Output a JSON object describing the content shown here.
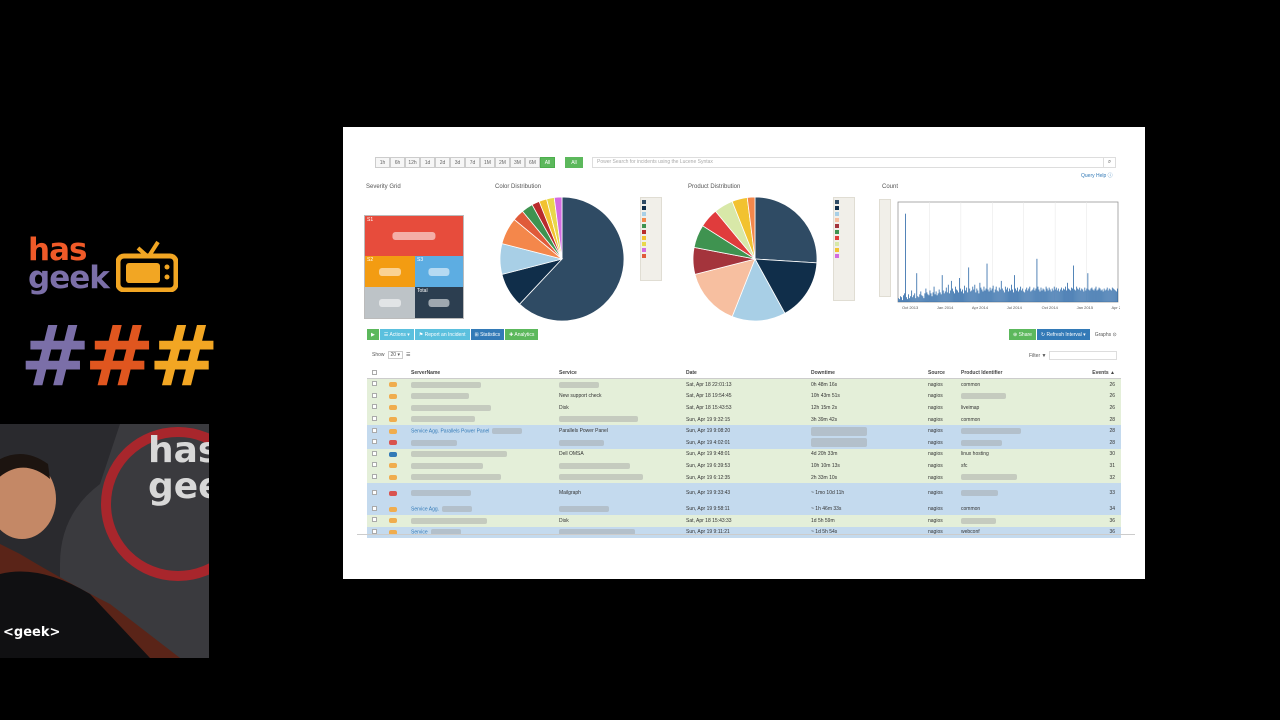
{
  "branding": {
    "line1": "has",
    "line2": "geek",
    "hashes": "###"
  },
  "colors": {
    "green": "#5cb85c",
    "blue": "#337ab7",
    "row_green": "#e4efd9",
    "row_blue": "#c4daee",
    "critical": "#e74c3c",
    "warning": "#f39c12",
    "unknown": "#5dade2",
    "total": "#2c3e50"
  },
  "toolbar": {
    "ranges": [
      "1h",
      "6h",
      "12h",
      "1d",
      "2d",
      "3d",
      "7d",
      "1M",
      "2M",
      "3M",
      "6M",
      "All"
    ],
    "active": "All",
    "all_button": "All",
    "search_placeholder": "Power Search for incidents using the Lucene Syntax",
    "query_help": "Query Help ⓘ"
  },
  "panels": {
    "severity_title": "Severity Grid",
    "color_title": "Color Distribution",
    "product_title": "Product Distribution",
    "count_title": "Count"
  },
  "severity_grid": {
    "cells": [
      {
        "key": "S1",
        "color": "#e74c3c"
      },
      {
        "key": "S2",
        "color": "#f39c12"
      },
      {
        "key": "S3",
        "color": "#5dade2"
      },
      {
        "key": "",
        "color": "#bdc3c7"
      },
      {
        "key": "Total",
        "color": "#2c3e50"
      }
    ]
  },
  "color_pie": {
    "slices": [
      {
        "value": 62,
        "color": "#2f4b64"
      },
      {
        "value": 9,
        "color": "#102e4a"
      },
      {
        "value": 8,
        "color": "#a8cfe6"
      },
      {
        "value": 7,
        "color": "#f4874b"
      },
      {
        "value": 3,
        "color": "#e05b3a"
      },
      {
        "value": 3,
        "color": "#3f9350"
      },
      {
        "value": 2,
        "color": "#b92c2c"
      },
      {
        "value": 2,
        "color": "#f2c230"
      },
      {
        "value": 2,
        "color": "#e8d84a"
      },
      {
        "value": 2,
        "color": "#d36be0"
      }
    ],
    "legend_colors": [
      "#2f4b64",
      "#102e4a",
      "#a8cfe6",
      "#f4874b",
      "#3f9350",
      "#b92c2c",
      "#f2c230",
      "#e8d84a",
      "#d36be0",
      "#e05b3a"
    ]
  },
  "product_pie": {
    "slices": [
      {
        "value": 26,
        "color": "#2f4b64"
      },
      {
        "value": 16,
        "color": "#102e4a"
      },
      {
        "value": 14,
        "color": "#a8cfe6"
      },
      {
        "value": 15,
        "color": "#f7bfa0"
      },
      {
        "value": 7,
        "color": "#a4343c"
      },
      {
        "value": 6,
        "color": "#3f9350"
      },
      {
        "value": 5,
        "color": "#e03c3c"
      },
      {
        "value": 5,
        "color": "#d8e8a8"
      },
      {
        "value": 4,
        "color": "#f2c230"
      },
      {
        "value": 2,
        "color": "#f4874b"
      }
    ],
    "legend_colors": [
      "#2f4b64",
      "#102e4a",
      "#a8cfe6",
      "#f7bfa0",
      "#a4343c",
      "#3f9350",
      "#e03c3c",
      "#d8e8a8",
      "#f2c230",
      "#d36be0"
    ]
  },
  "chart_data": {
    "type": "bar",
    "title": "Count",
    "x_ticks": [
      "Oct 2013",
      "Jan 2014",
      "Apr 2014",
      "Jul 2014",
      "Oct 2014",
      "Jan 2015",
      "Apr 2015"
    ],
    "ylim": [
      0,
      100
    ],
    "values": [
      4,
      3,
      6,
      5,
      2,
      7,
      9,
      92,
      5,
      3,
      8,
      4,
      6,
      12,
      5,
      7,
      9,
      4,
      30,
      6,
      5,
      8,
      11,
      7,
      6,
      4,
      9,
      14,
      10,
      8,
      7,
      12,
      9,
      6,
      10,
      16,
      8,
      11,
      7,
      9,
      13,
      10,
      8,
      28,
      12,
      9,
      11,
      15,
      10,
      18,
      9,
      12,
      22,
      14,
      11,
      9,
      16,
      13,
      12,
      10,
      25,
      14,
      11,
      13,
      9,
      17,
      12,
      15,
      10,
      36,
      14,
      11,
      12,
      16,
      13,
      18,
      10,
      14,
      12,
      9,
      20,
      15,
      13,
      11,
      16,
      12,
      14,
      40,
      13,
      11,
      15,
      12,
      14,
      17,
      10,
      13,
      16,
      12,
      11,
      15,
      13,
      22,
      14,
      12,
      10,
      16,
      13,
      15,
      11,
      14,
      12,
      18,
      13,
      10,
      28,
      14,
      12,
      15,
      11,
      13,
      16,
      12,
      14,
      11,
      10,
      13,
      15,
      12,
      14,
      16,
      11,
      12,
      13,
      15,
      12,
      14,
      45,
      16,
      13,
      11,
      15,
      12,
      14,
      13,
      11,
      16,
      14,
      12,
      15,
      13,
      11,
      14,
      12,
      16,
      13,
      15,
      12,
      14,
      11,
      13,
      15,
      12,
      14,
      13,
      16,
      12,
      20,
      14,
      13,
      12,
      15,
      14,
      38,
      13,
      12,
      16,
      14,
      13,
      15,
      12,
      14,
      13,
      11,
      15,
      12,
      14,
      30,
      13,
      12,
      14,
      15,
      13,
      12,
      14,
      16,
      12,
      13,
      15,
      14,
      12,
      13,
      11,
      14,
      12,
      13,
      15,
      12,
      14,
      13,
      12,
      15,
      14,
      13,
      12,
      11,
      14
    ]
  },
  "actions": {
    "buttons": [
      {
        "label": "▶",
        "color": "#5cb85c"
      },
      {
        "label": "☰ Actions ▾",
        "color": "#5bc0de"
      },
      {
        "label": "⚑ Report an Incident",
        "color": "#5bc0de"
      },
      {
        "label": "⊞ Statistics",
        "color": "#337ab7"
      },
      {
        "label": "✚ Analytics",
        "color": "#5cb85c"
      }
    ],
    "share": "⊕ Share",
    "refresh": "↻ Refresh Interval ▾",
    "graphs": "Graphs ⊙"
  },
  "table_controls": {
    "show_label": "Show",
    "show_value": "20 ▾",
    "filter_label": "Filter ▼"
  },
  "table": {
    "columns": [
      "",
      "",
      "ServerName",
      "Service",
      "Date",
      "Downtime",
      "Source",
      "Product Identifier",
      "Events ▲"
    ],
    "rows": [
      {
        "tone": "green",
        "badge": "#f0ad4e",
        "server": "",
        "service": "",
        "date": "Sat, Apr 18 22:01:13",
        "downtime": "0h 48m 16s",
        "source": "nagios",
        "product": "common",
        "events": "26"
      },
      {
        "tone": "green",
        "badge": "#f0ad4e",
        "server": "",
        "service": "New support check",
        "date": "Sat, Apr 18 19:54:45",
        "downtime": "10h 43m 51s",
        "source": "nagios",
        "product": "",
        "events": "26"
      },
      {
        "tone": "green",
        "badge": "#f0ad4e",
        "server": "",
        "service": "Disk",
        "date": "Sat, Apr 18 15:43:53",
        "downtime": "12h 15m 2s",
        "source": "nagios",
        "product": "liveimap",
        "events": "26"
      },
      {
        "tone": "green",
        "badge": "#f0ad4e",
        "server": "",
        "service": "",
        "date": "Sun, Apr 19 9:32:15",
        "downtime": "3h 39m 42s",
        "source": "nagios",
        "product": "common",
        "events": "28"
      },
      {
        "tone": "blue",
        "badge": "#f0ad4e",
        "server": "Service Agg. Parallels Power Panel",
        "service": "Parallels Power Panel",
        "date": "Sun, Apr 19 9:08:20",
        "downtime": "",
        "source": "nagios",
        "product": "",
        "events": "28"
      },
      {
        "tone": "blue",
        "badge": "#d9534f",
        "server": "",
        "service": "",
        "date": "Sun, Apr 19 4:02:01",
        "downtime": "",
        "source": "nagios",
        "product": "",
        "events": "28"
      },
      {
        "tone": "green",
        "badge": "#337ab7",
        "server": "",
        "service": "Dell OMSA",
        "date": "Sun, Apr 19 9:48:01",
        "downtime": "4d 20h 33m",
        "source": "nagios",
        "product": "linux hosting",
        "events": "30"
      },
      {
        "tone": "green",
        "badge": "#f0ad4e",
        "server": "",
        "service": "",
        "date": "Sun, Apr 19 6:39:53",
        "downtime": "10h 10m 13s",
        "source": "nagios",
        "product": "sfc",
        "events": "31"
      },
      {
        "tone": "green",
        "badge": "#f0ad4e",
        "server": "",
        "service": "",
        "date": "Sun, Apr 19 6:12:35",
        "downtime": "2h 33m 10s",
        "source": "nagios",
        "product": "",
        "events": "32"
      },
      {
        "tone": "blue",
        "badge": "#d9534f",
        "server": "",
        "service": "Mailgraph",
        "date": "Sun, Apr 19 9:33:43",
        "downtime": "~ 1mo 10d 11h",
        "source": "nagios",
        "product": "",
        "events": "33",
        "tall": true
      },
      {
        "tone": "blue",
        "badge": "#f0ad4e",
        "server": "Service Agg.",
        "service": "",
        "date": "Sun, Apr 19 9:58:11",
        "downtime": "~ 1h 46m 33s",
        "source": "nagios",
        "product": "common",
        "events": "34"
      },
      {
        "tone": "green",
        "badge": "#f0ad4e",
        "server": "",
        "service": "Disk",
        "date": "Sat, Apr 18 15:43:33",
        "downtime": "1d 5h 59m",
        "source": "nagios",
        "product": "",
        "events": "36"
      },
      {
        "tone": "blue",
        "badge": "#f0ad4e",
        "server": "Service",
        "service": "",
        "date": "Sun, Apr 19 9:11:21",
        "downtime": "~ 1d 5h 54s",
        "source": "nagios",
        "product": "webconf",
        "events": "36"
      }
    ]
  }
}
